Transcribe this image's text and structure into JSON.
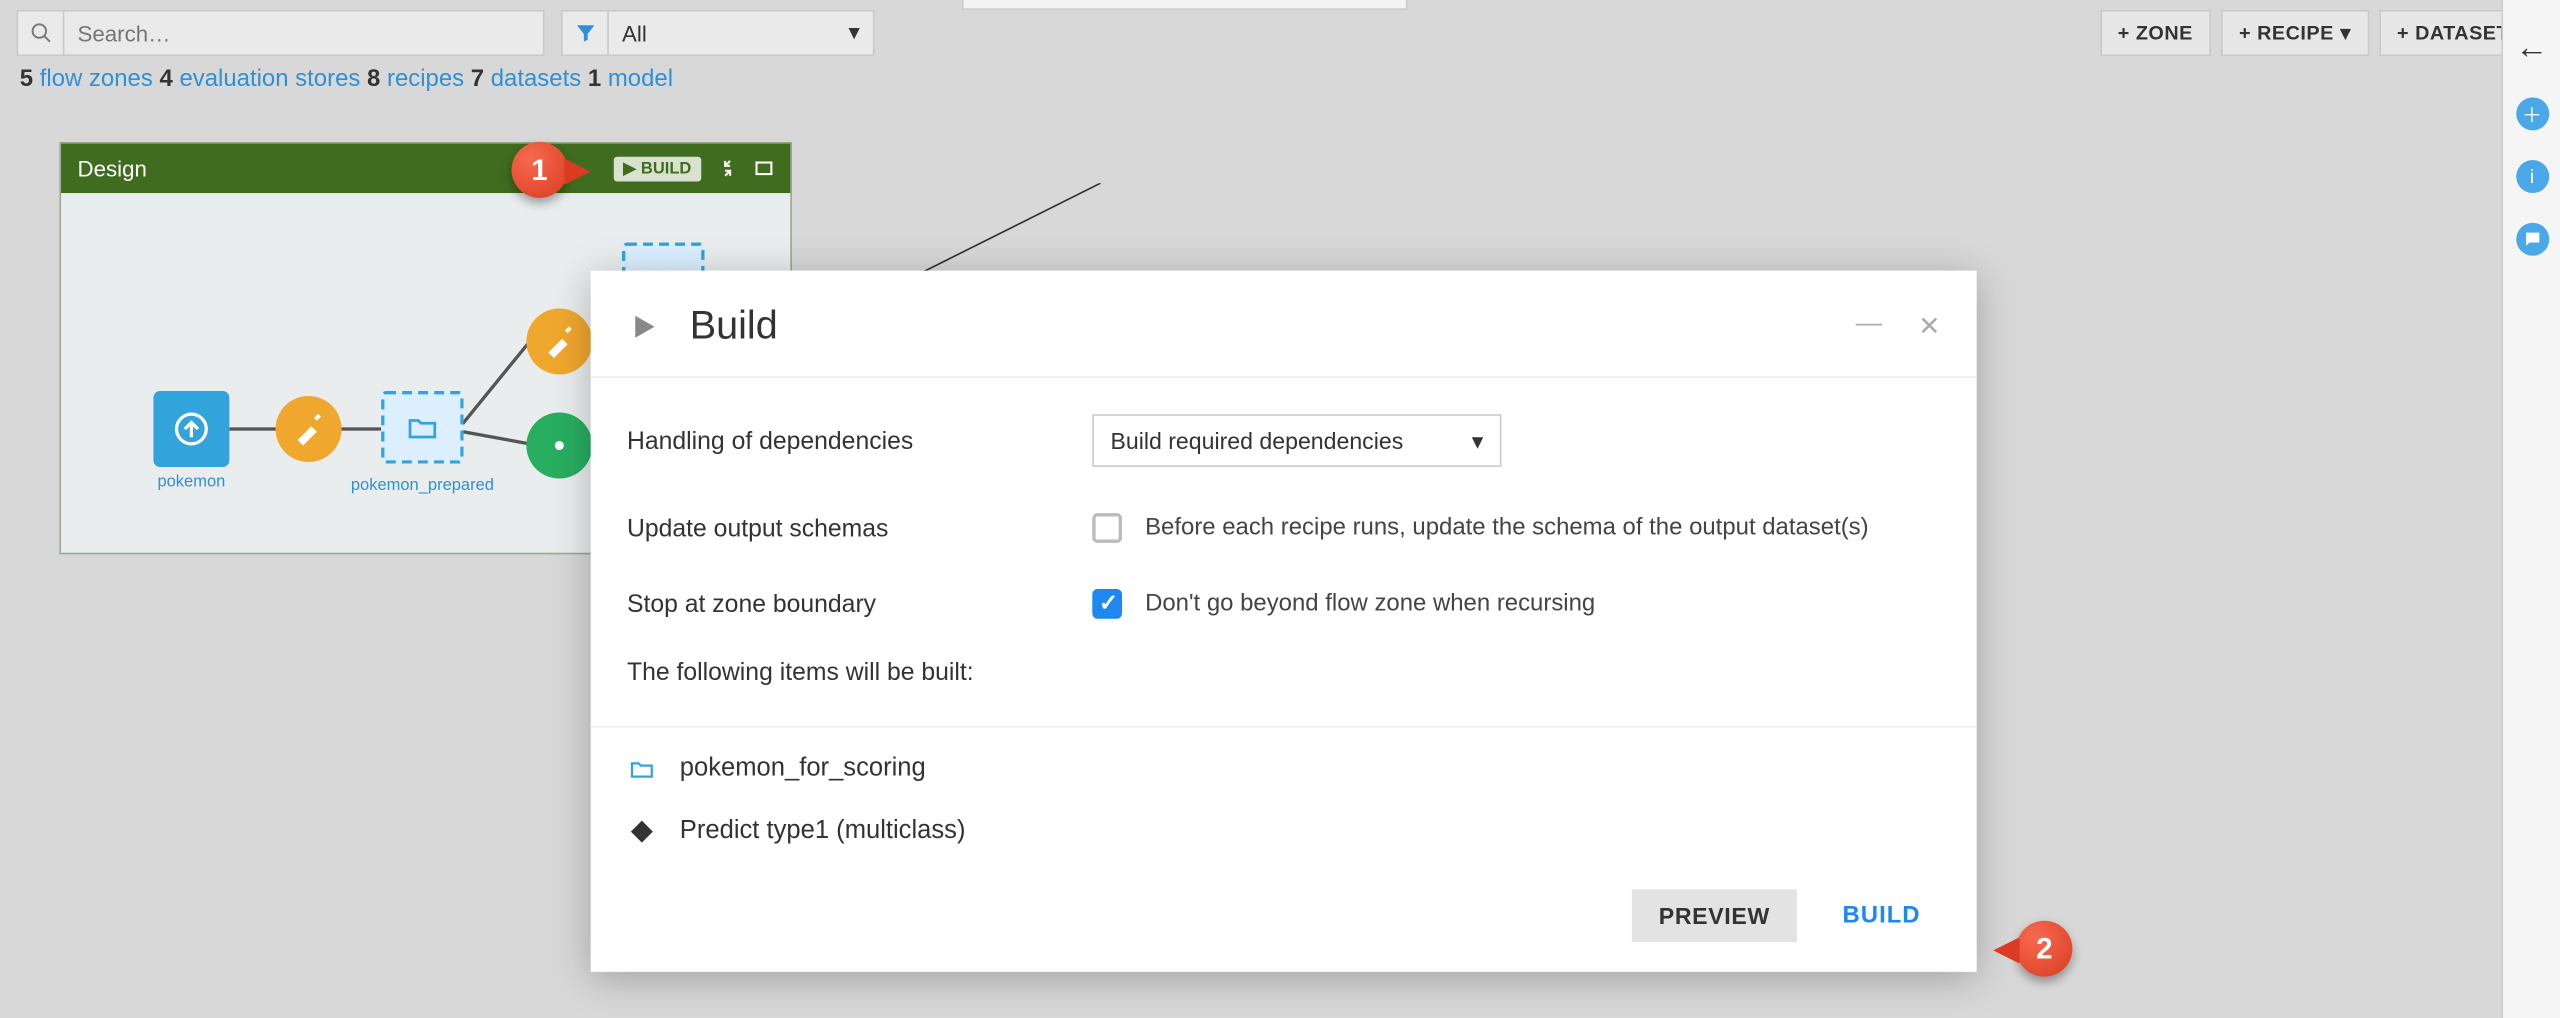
{
  "toolbar": {
    "search_placeholder": "Search…",
    "filter_selected": "All",
    "add_zone": "+ ZONE",
    "add_recipe": "+ RECIPE",
    "add_dataset": "+ DATASET"
  },
  "stats": {
    "flow_zones_n": "5",
    "flow_zones": "flow zones",
    "eval_stores_n": "4",
    "eval_stores": "evaluation stores",
    "recipes_n": "8",
    "recipes": "recipes",
    "datasets_n": "7",
    "datasets": "datasets",
    "models_n": "1",
    "models": "model"
  },
  "zone": {
    "title": "Design",
    "build_label": "BUILD",
    "nodes": {
      "upload_label": "pokemon",
      "prepared_label": "pokemon_prepared"
    }
  },
  "modal": {
    "title": "Build",
    "dep_label": "Handling of dependencies",
    "dep_selected": "Build required dependencies",
    "schema_label": "Update output schemas",
    "schema_check_text": "Before each recipe runs, update the schema of the output dataset(s)",
    "boundary_label": "Stop at zone boundary",
    "boundary_check_text": "Don't go beyond flow zone when recursing",
    "items_heading": "The following items will be built:",
    "items": [
      {
        "name": "pokemon_for_scoring",
        "icon": "folder"
      },
      {
        "name": "Predict type1 (multiclass)",
        "icon": "diamond"
      }
    ],
    "preview": "PREVIEW",
    "build": "BUILD"
  },
  "callouts": {
    "one": "1",
    "two": "2"
  }
}
